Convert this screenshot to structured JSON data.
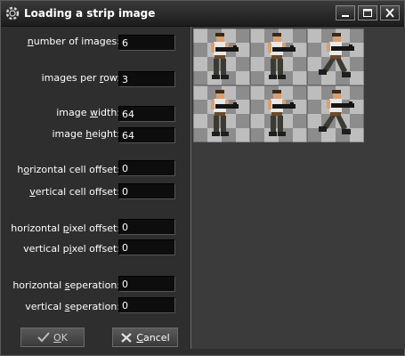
{
  "window": {
    "title": "Loading a strip image",
    "icon": "gear-icon",
    "controls": [
      "minimize-icon",
      "maximize-icon",
      "close-icon"
    ]
  },
  "fields": {
    "number_of_images": {
      "label_pre": "",
      "label_u": "n",
      "label_post": "umber of images:",
      "value": "6"
    },
    "images_per_row": {
      "label_pre": "images per ",
      "label_u": "r",
      "label_post": "ow:",
      "value": "3"
    },
    "image_width": {
      "label_pre": "image ",
      "label_u": "w",
      "label_post": "idth:",
      "value": "64"
    },
    "image_height": {
      "label_pre": "image ",
      "label_u": "h",
      "label_post": "eight:",
      "value": "64"
    },
    "horizontal_cell_offset": {
      "label_pre": "h",
      "label_u": "o",
      "label_post": "rizontal cell offset:",
      "value": "0"
    },
    "vertical_cell_offset": {
      "label_pre": "",
      "label_u": "v",
      "label_post": "ertical cell offset:",
      "value": "0"
    },
    "horizontal_pixel_offset": {
      "label_pre": "horizontal ",
      "label_u": "p",
      "label_post": "ixel offset:",
      "value": "0"
    },
    "vertical_pixel_offset": {
      "label_pre": "vertical p",
      "label_u": "i",
      "label_post": "xel offset:",
      "value": "0"
    },
    "horizontal_separation": {
      "label_pre": "horizontal ",
      "label_u": "s",
      "label_post": "eperation:",
      "value": "0"
    },
    "vertical_separation": {
      "label_pre": "vertical ",
      "label_u": "s",
      "label_post": "eperation:",
      "value": "0"
    }
  },
  "buttons": {
    "ok": {
      "label_u": "O",
      "label_post": "K",
      "icon": "checkmark-icon"
    },
    "cancel": {
      "label_u": "C",
      "label_post": "ancel",
      "icon": "cancel-x-icon"
    }
  },
  "preview": {
    "columns": 3,
    "rows": 2,
    "frames": [
      "run-frame-1",
      "run-frame-2",
      "run-frame-3",
      "run-frame-4",
      "run-frame-5",
      "run-frame-6"
    ],
    "checker_light": "#bdbdbd",
    "checker_dark": "#8c8c8c"
  }
}
